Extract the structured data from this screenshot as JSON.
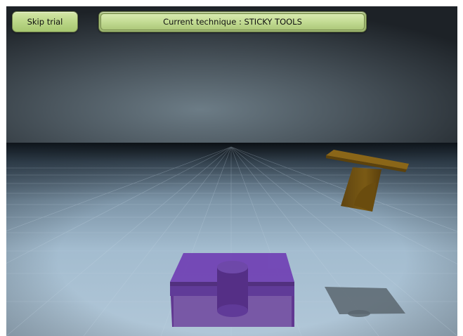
{
  "toolbar": {
    "skip_label": "Skip trial",
    "technique_label": "Current technique : STICKY TOOLS"
  },
  "scene": {
    "target_color": "#6a3aa6",
    "target_shadow_color": "#55606a",
    "object_color": "#7a5a12",
    "floor_color": "#a7c0d4",
    "sky_color": "#5f6e78"
  }
}
